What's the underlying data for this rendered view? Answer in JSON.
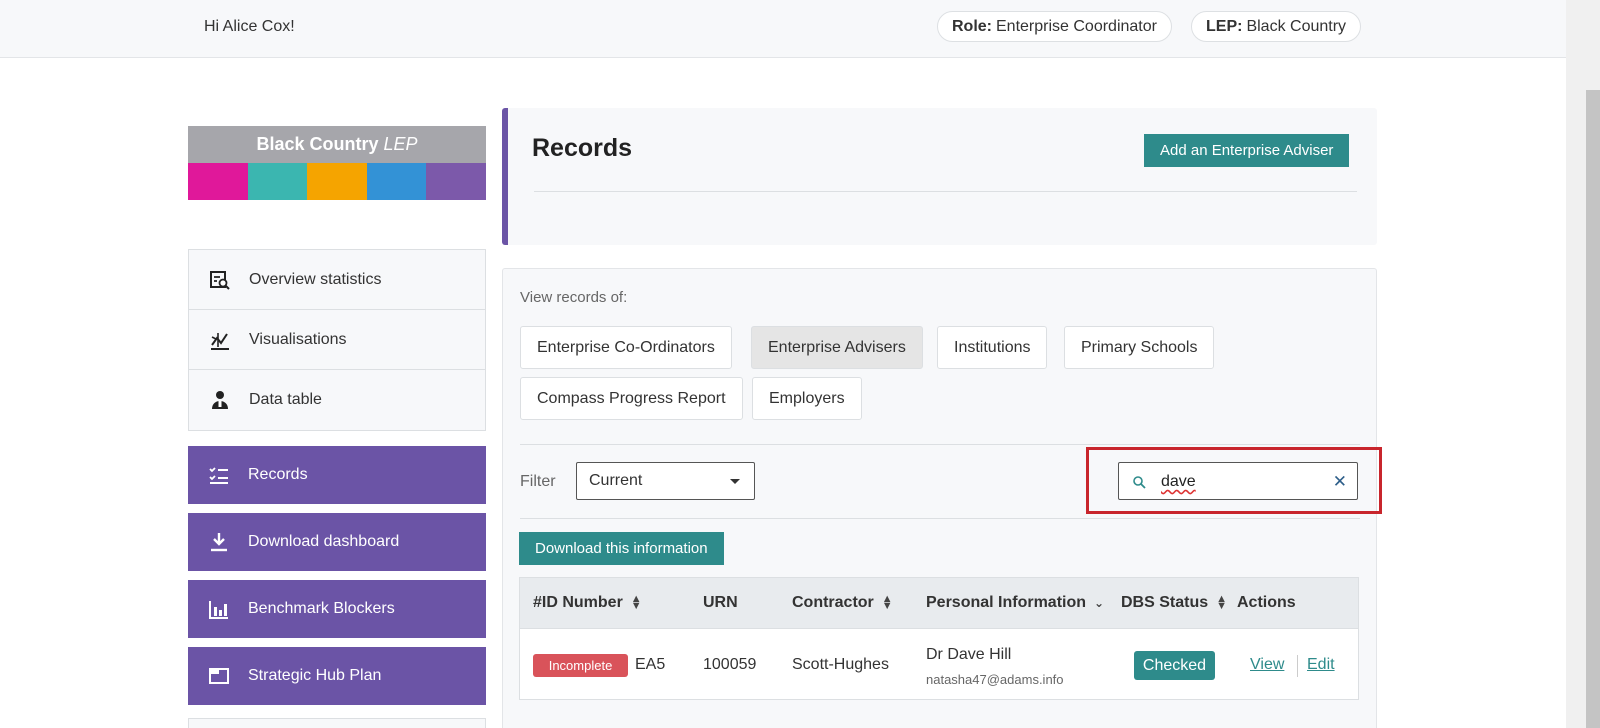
{
  "header": {
    "greeting": "Hi Alice Cox!",
    "role_label": "Role:",
    "role_value": "Enterprise Coordinator",
    "lep_label": "LEP:",
    "lep_value": "Black Country"
  },
  "logo": {
    "text_bold": "Black Country",
    "text_italic": "LEP",
    "bar_colors": [
      "#e0189a",
      "#3bb6b0",
      "#f5a400",
      "#3392d6",
      "#7c59aa"
    ]
  },
  "sidebar": {
    "items": [
      {
        "label": "Overview statistics",
        "icon": "chart-search-icon"
      },
      {
        "label": "Visualisations",
        "icon": "line-chart-icon"
      },
      {
        "label": "Data table",
        "icon": "person-icon"
      }
    ],
    "actions": [
      {
        "label": "Records",
        "icon": "checklist-icon"
      },
      {
        "label": "Download dashboard",
        "icon": "download-icon"
      },
      {
        "label": "Benchmark Blockers",
        "icon": "bar-chart-icon"
      },
      {
        "label": "Strategic Hub Plan",
        "icon": "window-icon"
      }
    ]
  },
  "records": {
    "title": "Records",
    "add_button": "Add an Enterprise Adviser"
  },
  "view": {
    "label": "View records of:",
    "tabs": [
      {
        "label": "Enterprise Co-Ordinators",
        "active": false
      },
      {
        "label": "Enterprise Advisers",
        "active": true
      },
      {
        "label": "Institutions",
        "active": false
      },
      {
        "label": "Primary Schools",
        "active": false
      },
      {
        "label": "Compass Progress Report",
        "active": false
      },
      {
        "label": "Employers",
        "active": false
      }
    ]
  },
  "filter": {
    "label": "Filter",
    "selected": "Current"
  },
  "search": {
    "value": "dave",
    "clear_symbol": "✕"
  },
  "download_button": "Download this information",
  "table": {
    "headers": {
      "id": "#ID Number",
      "urn": "URN",
      "contractor": "Contractor",
      "personal": "Personal Information",
      "dbs": "DBS Status",
      "actions": "Actions"
    },
    "rows": [
      {
        "status": "Incomplete",
        "id": "EA5",
        "urn": "100059",
        "contractor": "Scott-Hughes",
        "name": "Dr Dave Hill",
        "email": "natasha47@adams.info",
        "dbs": "Checked",
        "view": "View",
        "edit": "Edit"
      }
    ]
  },
  "colors": {
    "brand_purple": "#6b54a6",
    "teal": "#2e8b8b",
    "incomplete_red": "#d9535a",
    "highlight_red": "#c8252c"
  }
}
